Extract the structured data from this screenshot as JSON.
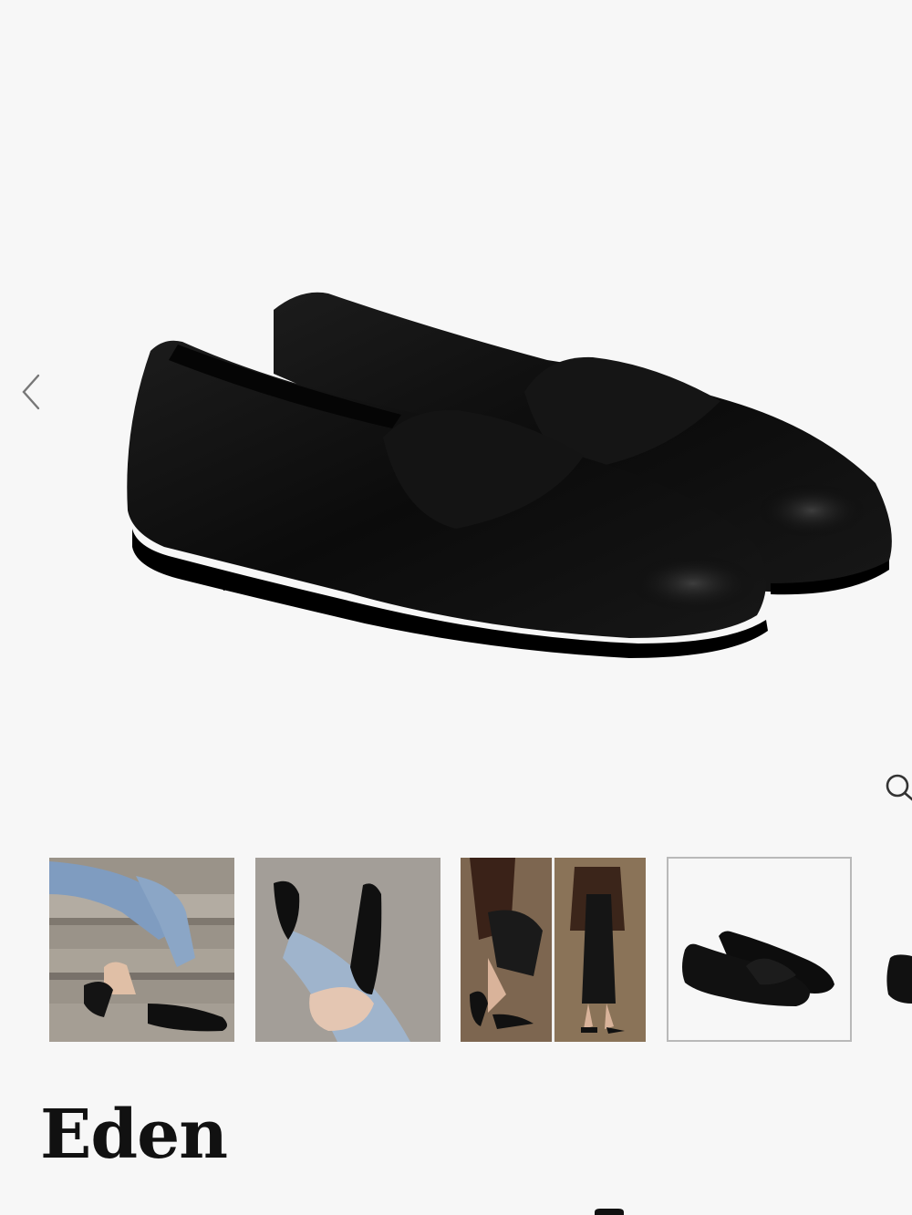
{
  "gallery": {
    "main_image": "black-leather-loafers-pair",
    "prev_icon": "chevron-left-icon",
    "zoom_icon": "magnifier-icon",
    "thumbnails": [
      {
        "name": "thumbnail-loafer-stairs"
      },
      {
        "name": "thumbnail-loafer-closeup"
      },
      {
        "name": "thumbnail-loafer-outfit"
      },
      {
        "name": "thumbnail-loafer-product",
        "selected": true
      },
      {
        "name": "thumbnail-loafer-next"
      }
    ]
  },
  "product": {
    "title": "Eden"
  },
  "colors": {
    "background": "#f7f7f7",
    "shoe": "#0d0d0d",
    "title": "#111111",
    "thumb_border": "#b9b9b9"
  }
}
